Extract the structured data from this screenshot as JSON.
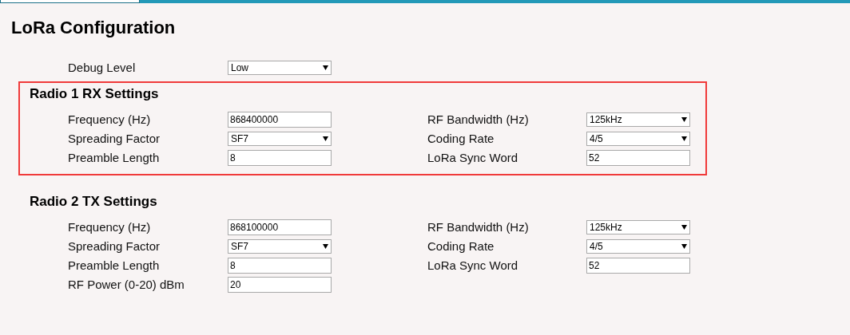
{
  "tabs": [
    {
      "selected": true
    },
    {
      "selected": false
    }
  ],
  "title": "LoRa Configuration",
  "debug": {
    "label": "Debug Level",
    "kind": "select",
    "value": "Low"
  },
  "sections": [
    {
      "title": "Radio 1 RX Settings",
      "highlighted": true,
      "rows": [
        {
          "left": {
            "label": "Frequency (Hz)",
            "kind": "input",
            "value": "868400000"
          },
          "right": {
            "label": "RF Bandwidth (Hz)",
            "kind": "select",
            "value": "125kHz"
          }
        },
        {
          "left": {
            "label": "Spreading Factor",
            "kind": "select",
            "value": "SF7"
          },
          "right": {
            "label": "Coding Rate",
            "kind": "select",
            "value": "4/5"
          }
        },
        {
          "left": {
            "label": "Preamble Length",
            "kind": "input",
            "value": "8"
          },
          "right": {
            "label": "LoRa Sync Word",
            "kind": "input",
            "value": "52"
          }
        }
      ]
    },
    {
      "title": "Radio 2 TX Settings",
      "highlighted": false,
      "rows": [
        {
          "left": {
            "label": "Frequency (Hz)",
            "kind": "input",
            "value": "868100000"
          },
          "right": {
            "label": "RF Bandwidth (Hz)",
            "kind": "select",
            "value": "125kHz"
          }
        },
        {
          "left": {
            "label": "Spreading Factor",
            "kind": "select",
            "value": "SF7"
          },
          "right": {
            "label": "Coding Rate",
            "kind": "select",
            "value": "4/5"
          }
        },
        {
          "left": {
            "label": "Preamble Length",
            "kind": "input",
            "value": "8"
          },
          "right": {
            "label": "LoRa Sync Word",
            "kind": "input",
            "value": "52"
          }
        },
        {
          "left": {
            "label": "RF Power (0-20) dBm",
            "kind": "input",
            "value": "20"
          }
        }
      ]
    }
  ]
}
